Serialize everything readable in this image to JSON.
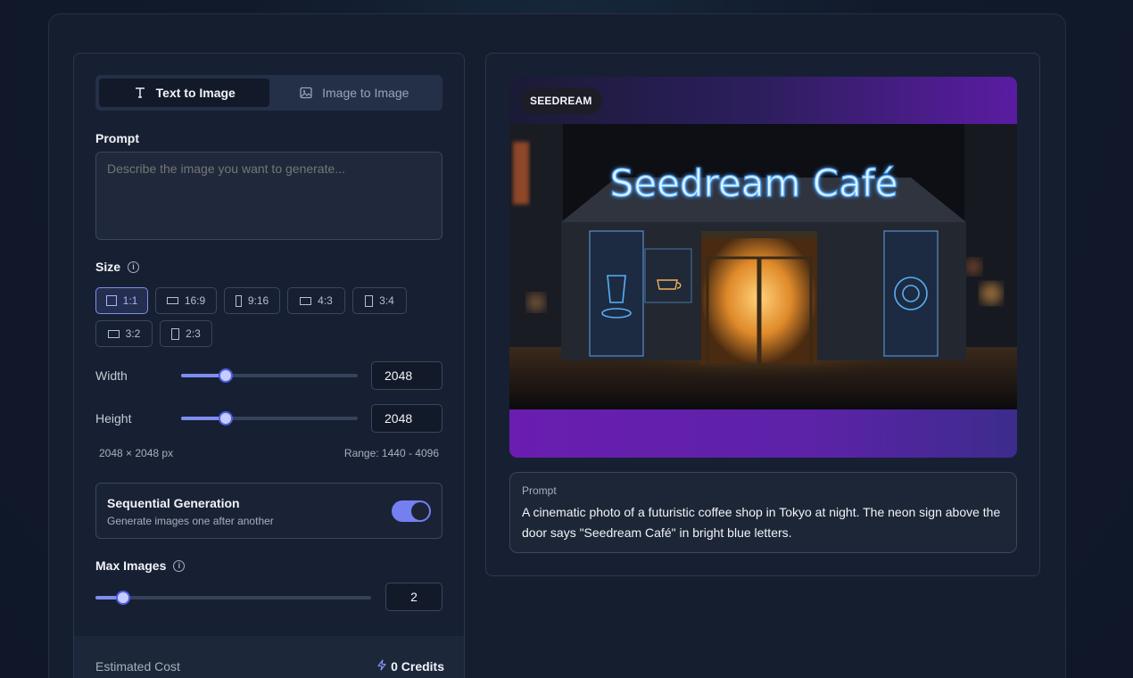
{
  "tabs": [
    {
      "label": "Text to Image",
      "icon": "text-icon",
      "active": true
    },
    {
      "label": "Image to Image",
      "icon": "image-icon",
      "active": false
    }
  ],
  "prompt": {
    "label": "Prompt",
    "placeholder": "Describe the image you want to generate...",
    "value": ""
  },
  "size": {
    "label": "Size",
    "options": [
      {
        "label": "1:1",
        "active": true
      },
      {
        "label": "16:9",
        "active": false
      },
      {
        "label": "9:16",
        "active": false
      },
      {
        "label": "4:3",
        "active": false
      },
      {
        "label": "3:4",
        "active": false
      },
      {
        "label": "3:2",
        "active": false
      },
      {
        "label": "2:3",
        "active": false
      }
    ]
  },
  "width": {
    "label": "Width",
    "value": "2048",
    "fraction": 0.25
  },
  "height": {
    "label": "Height",
    "value": "2048",
    "fraction": 0.25
  },
  "dimensions_text": "2048 × 2048 px",
  "range_text": "Range: 1440 - 4096",
  "sequential": {
    "title": "Sequential Generation",
    "subtitle": "Generate images one after another",
    "enabled": true
  },
  "max_images": {
    "label": "Max Images",
    "value": "2",
    "fraction": 0.1
  },
  "cost": {
    "label": "Estimated Cost",
    "value": "0 Credits"
  },
  "preview": {
    "badge": "SEEDREAM",
    "sign_text": "Seedream Café",
    "prompt_label": "Prompt",
    "prompt_text": "A cinematic photo of a futuristic coffee shop in Tokyo at night. The neon sign above the door says \"Seedream Café\" in bright blue letters."
  },
  "colors": {
    "accent": "#7f8df0",
    "neon": "#4aa8ff",
    "glow": "#f2a640"
  }
}
